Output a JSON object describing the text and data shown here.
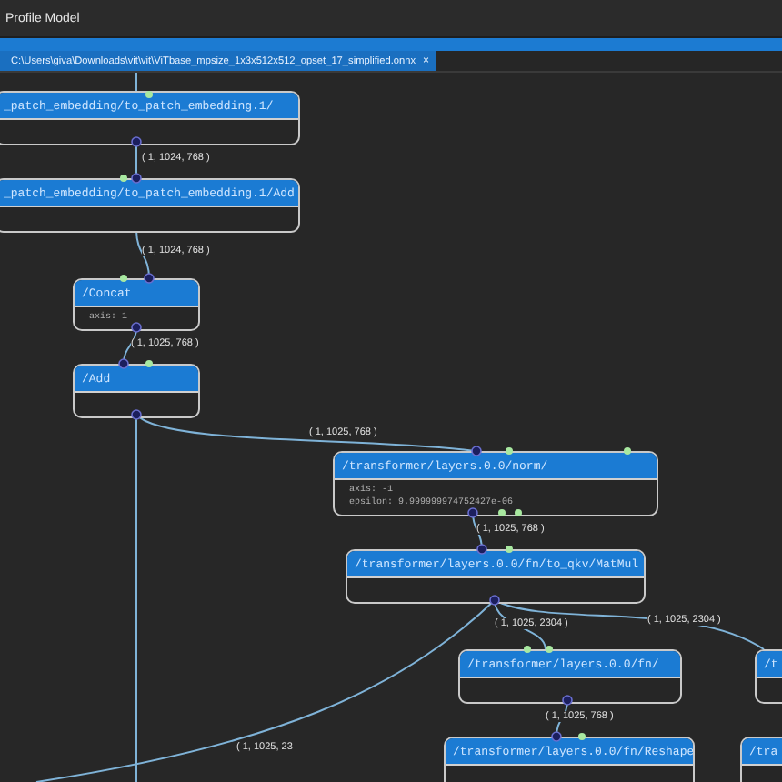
{
  "window": {
    "title": "Profile Model"
  },
  "tab": {
    "path": "C:\\Users\\giva\\Downloads\\vit\\vit\\ViTbase_mpsize_1x3x512x512_opset_17_simplified.onnx",
    "close": "×"
  },
  "nodes": [
    {
      "title": "_patch_embedding/to_patch_embedding.1/"
    },
    {
      "title": "_patch_embedding/to_patch_embedding.1/Add"
    },
    {
      "title": "/Concat",
      "attributes": [
        "axis: 1"
      ]
    },
    {
      "title": "/Add"
    },
    {
      "title": "/transformer/layers.0.0/norm/",
      "attributes": [
        "axis: -1",
        "epsilon: 9.999999974752427e-06"
      ]
    },
    {
      "title": "/transformer/layers.0.0/fn/to_qkv/MatMul"
    },
    {
      "title": "/transformer/layers.0.0/fn/"
    },
    {
      "title": "/transformer/layers.0.0/fn/Reshape"
    },
    {
      "title": "/t"
    },
    {
      "title": "/tra"
    }
  ],
  "edges": [
    {
      "label": "( 1, 1024, 768 )"
    },
    {
      "label": "( 1, 1024, 768 )"
    },
    {
      "label": "( 1, 1025, 768 )"
    },
    {
      "label": "( 1, 1025, 768 )"
    },
    {
      "label": "( 1, 1025, 768 )"
    },
    {
      "label": "( 1, 1025, 2304 )"
    },
    {
      "label": "( 1, 1025, 2304 )"
    },
    {
      "label": "( 1, 1025, 768 )"
    },
    {
      "label": "( 1, 1025, 23"
    }
  ]
}
